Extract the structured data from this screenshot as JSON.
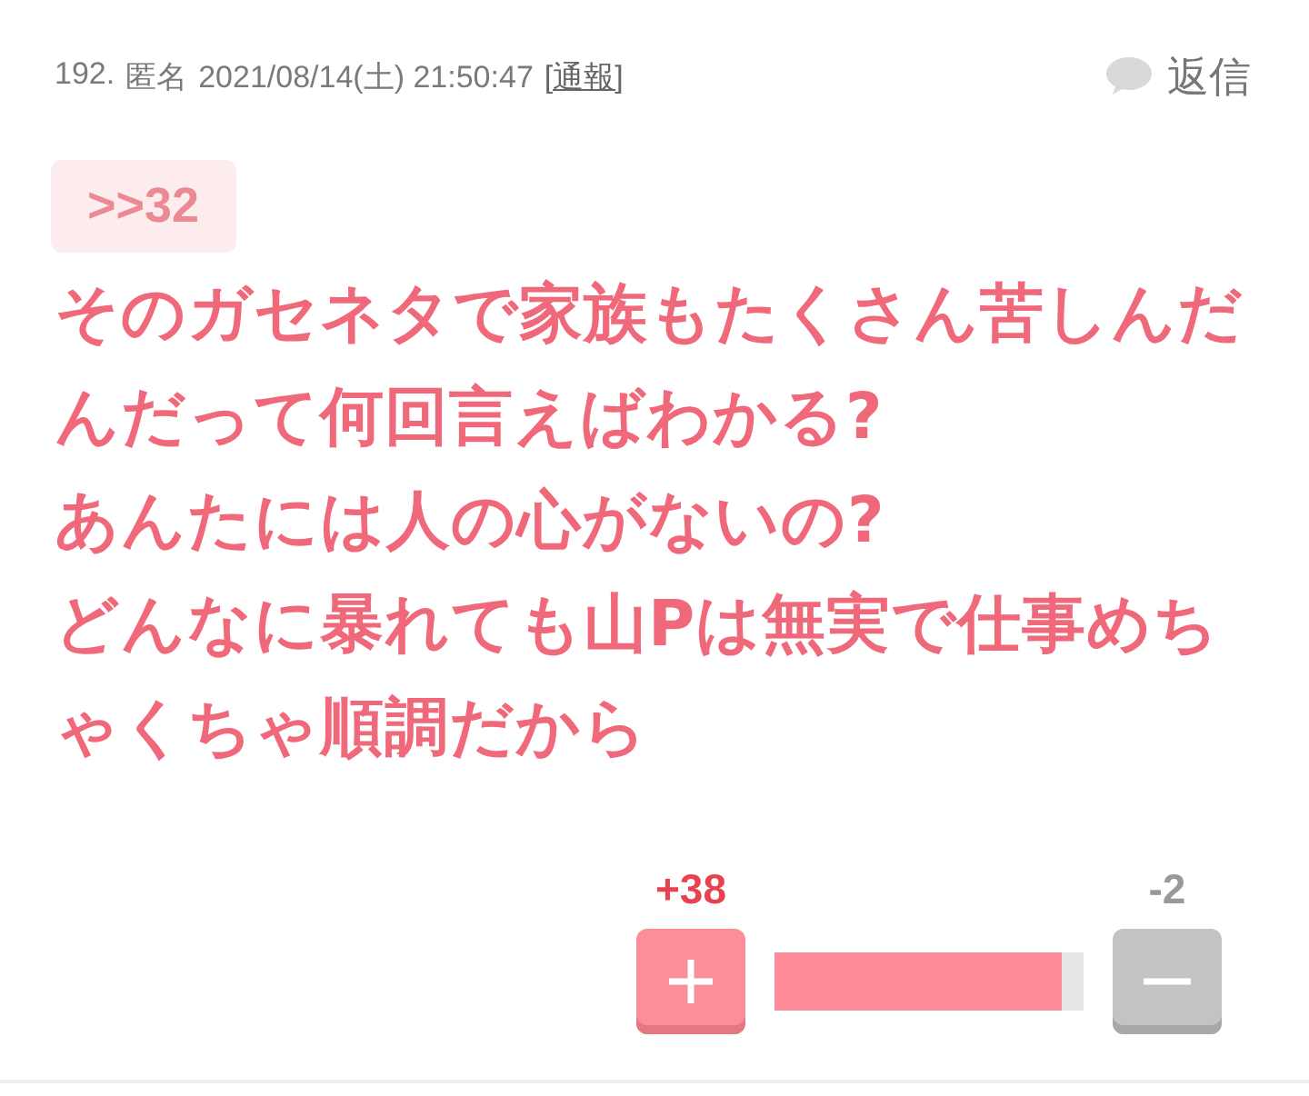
{
  "meta": {
    "number": "192.",
    "author": "匿名",
    "datetime": "2021/08/14(土) 21:50:47",
    "report": "[通報]"
  },
  "reply_button": {
    "label": "返信"
  },
  "anchor": ">>32",
  "body": "そのガセネタで家族もたくさん苦しんだんだって何回言えばわかる?\nあんたには人の心がないの?\nどんなに暴れても山Pは無実で仕事めちゃくちゃ順調だから",
  "votes": {
    "plus_count": "+38",
    "minus_count": "-2",
    "level": 0.93
  }
}
